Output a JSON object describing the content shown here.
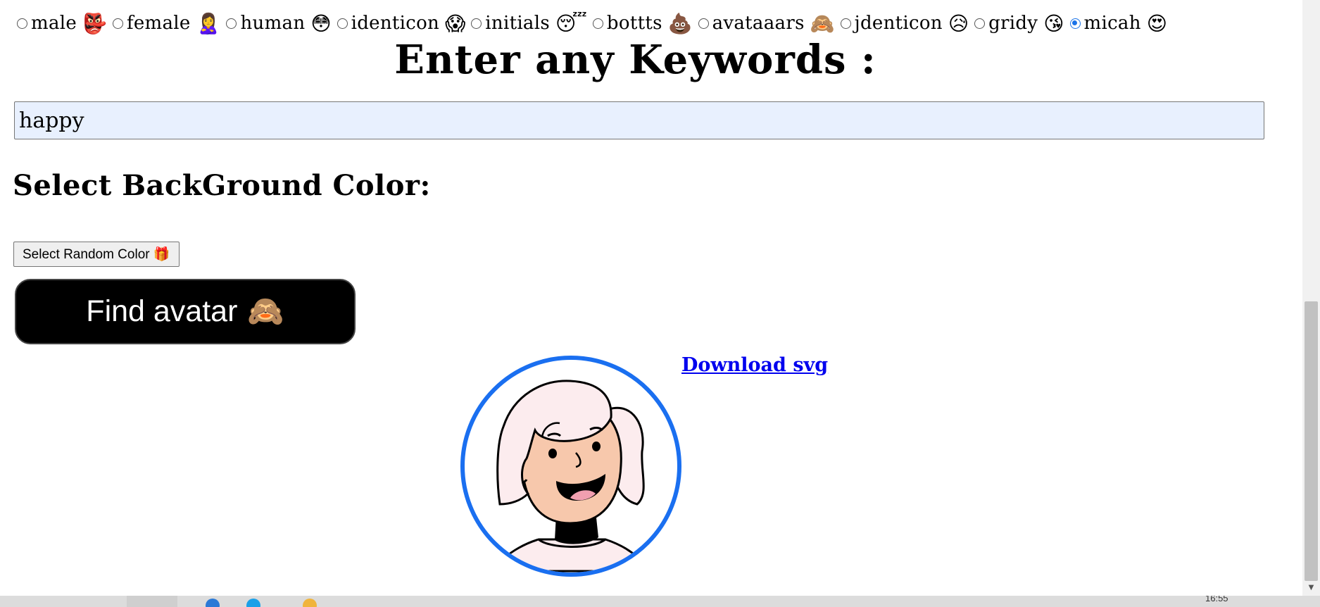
{
  "avatar_types": [
    {
      "label": "male",
      "emoji": "👺",
      "selected": false
    },
    {
      "label": "female",
      "emoji": "🙎‍♀️",
      "selected": false
    },
    {
      "label": "human",
      "emoji": "😳",
      "selected": false
    },
    {
      "label": "identicon",
      "emoji": "😱",
      "selected": false
    },
    {
      "label": "initials",
      "emoji": "😴",
      "selected": false
    },
    {
      "label": "bottts",
      "emoji": "💩",
      "selected": false
    },
    {
      "label": "avataaars",
      "emoji": "🙈",
      "selected": false
    },
    {
      "label": "jdenticon",
      "emoji": "😥",
      "selected": false
    },
    {
      "label": "gridy",
      "emoji": "😘",
      "selected": false
    },
    {
      "label": "micah",
      "emoji": "😍",
      "selected": true
    }
  ],
  "keywords": {
    "title": "Enter any Keywords :",
    "value": "happy"
  },
  "background": {
    "title": "Select BackGround Color:",
    "random_button": "Select Random Color 🎁"
  },
  "find_button": {
    "label": "Find avatar",
    "emoji": "🙈"
  },
  "download_link": "Download svg",
  "taskbar": {
    "clock": "16:55"
  },
  "colors": {
    "avatar_ring": "#1a6ff0",
    "input_bg": "#e8f0fe",
    "find_button_bg": "#000000",
    "link": "#0000ee",
    "hair": "#fcecee",
    "skin": "#f7c8ac"
  }
}
